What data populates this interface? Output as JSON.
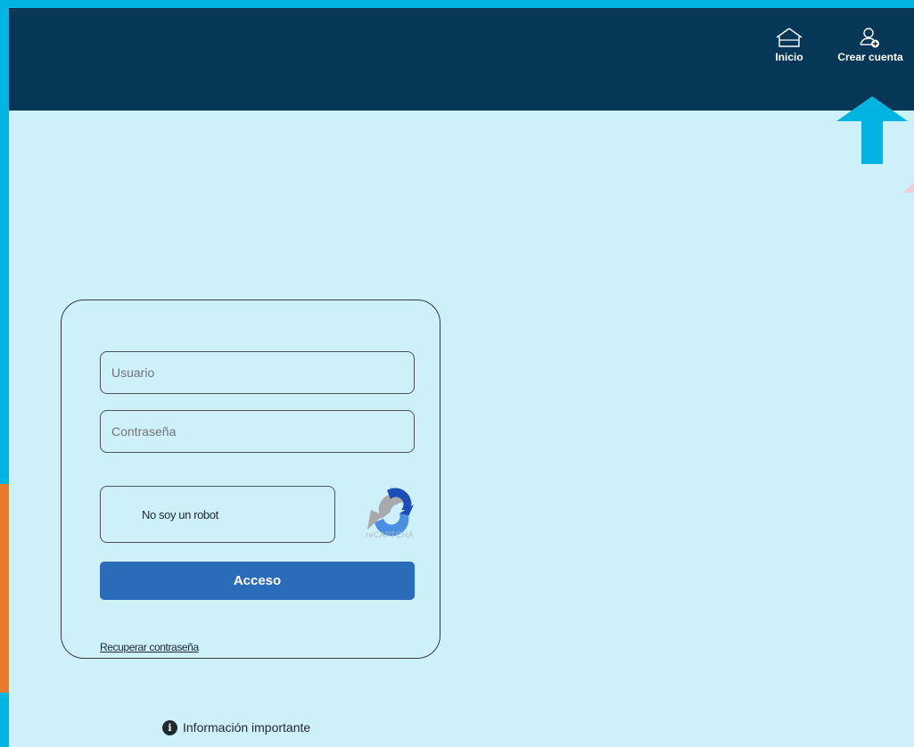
{
  "header": {
    "nav": [
      {
        "label": "Inicio",
        "icon": "home-icon"
      },
      {
        "label": "Crear cuenta",
        "icon": "user-add-icon"
      }
    ]
  },
  "login": {
    "username_placeholder": "Usuario",
    "password_placeholder": "Contraseña",
    "captcha": {
      "label": "No soy un robot",
      "brand": "reCAPTCHA"
    },
    "submit_label": "Acceso",
    "recover_label": "Recuperar contraseña"
  },
  "info": {
    "label": "Información importante",
    "icon": "info-icon",
    "icon_glyph": "i"
  },
  "colors": {
    "header_bg": "#073756",
    "page_bg": "#cdf0f9",
    "accent": "#00b5e2",
    "button": "#2a6cb7",
    "side_accent": "#e87c2d"
  }
}
